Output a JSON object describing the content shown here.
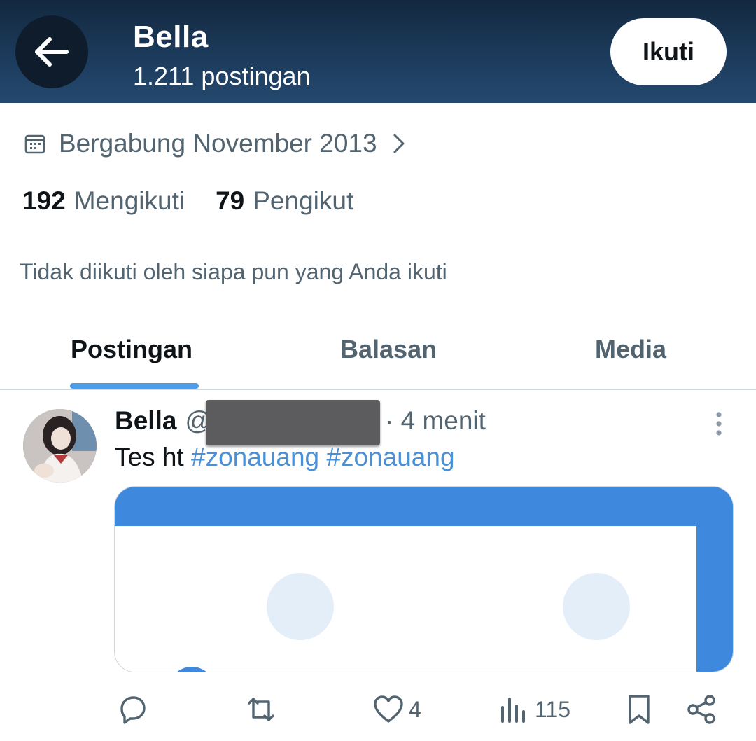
{
  "header": {
    "name": "Bella",
    "post_count": "1.211 postingan",
    "follow_label": "Ikuti"
  },
  "profile": {
    "joined": "Bergabung November 2013",
    "following_count": "192",
    "following_label": "Mengikuti",
    "followers_count": "79",
    "followers_label": "Pengikut",
    "not_followed_text": "Tidak diikuti oleh siapa pun yang Anda ikuti"
  },
  "tabs": [
    {
      "label": "Postingan",
      "active": true
    },
    {
      "label": "Balasan",
      "active": false
    },
    {
      "label": "Media",
      "active": false
    }
  ],
  "post": {
    "author_name": "Bella",
    "author_at": "@",
    "time": "· 4 menit",
    "text_plain": "Tes ht",
    "hashtag_1": "#zonauang",
    "hashtag_2": "#zonauang",
    "actions": {
      "reply_icon": "reply-icon",
      "retweet_icon": "retweet-icon",
      "like_count": "4",
      "views_count": "115",
      "bookmark_icon": "bookmark-icon",
      "share_icon": "share-icon"
    }
  },
  "colors": {
    "accent": "#4c9de8",
    "hashtag": "#4a90d6",
    "muted": "#536471",
    "header_bg": "#1c3b5c",
    "media_blue": "#3e88dd"
  }
}
